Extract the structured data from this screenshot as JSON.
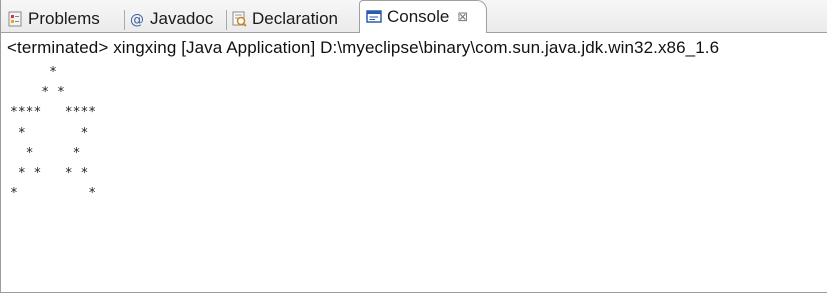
{
  "tabs": [
    {
      "label": "Problems",
      "icon": "problems-icon"
    },
    {
      "label": "Javadoc",
      "icon": "at-sign-icon"
    },
    {
      "label": "Declaration",
      "icon": "declaration-icon"
    },
    {
      "label": "Console",
      "icon": "console-icon",
      "active": true,
      "close_glyph": "⊠"
    }
  ],
  "console": {
    "status": "<terminated> xingxing [Java Application] D:\\myeclipse\\binary\\com.sun.java.jdk.win32.x86_1.6",
    "output_lines": [
      "     *",
      "    * *",
      "****   ****",
      " *       *",
      "  *     *",
      " * *   * *",
      "*         *"
    ]
  },
  "colors": {
    "tabbar_bg": "#efefef",
    "active_tab_bg": "#ffffff",
    "console_icon": "#2a5db0"
  }
}
